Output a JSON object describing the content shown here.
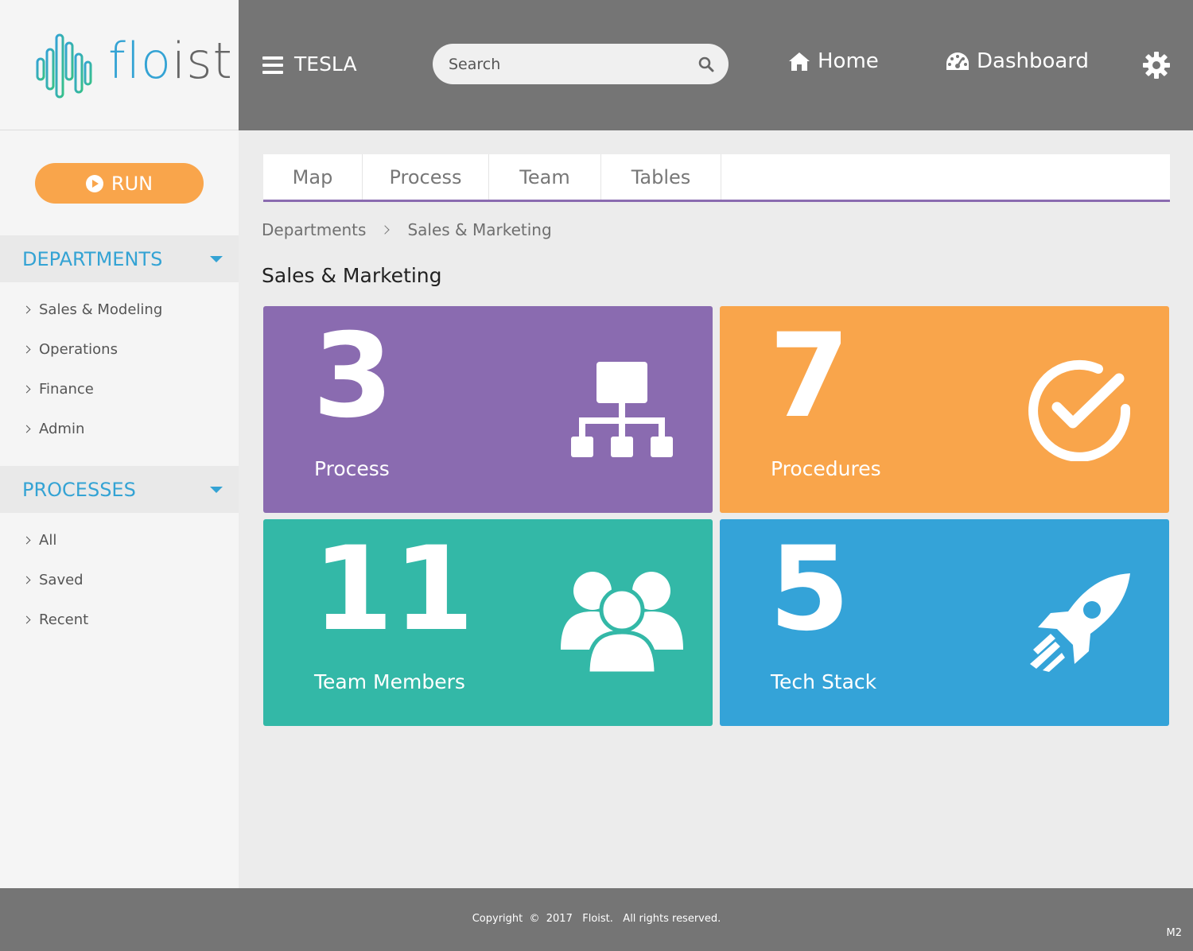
{
  "app": {
    "logo_text_main": "flo",
    "logo_text_tail": "ist"
  },
  "sidebar": {
    "run_label": "RUN",
    "sections": [
      {
        "title": "DEPARTMENTS",
        "items": [
          "Sales & Modeling",
          "Operations",
          "Finance",
          "Admin"
        ]
      },
      {
        "title": "PROCESSES",
        "items": [
          "All",
          "Saved",
          "Recent"
        ]
      }
    ]
  },
  "header": {
    "org_name": "TESLA",
    "search_placeholder": "Search",
    "home_label": "Home",
    "dashboard_label": "Dashboard"
  },
  "tabs": [
    "Map",
    "Process",
    "Team",
    "Tables"
  ],
  "breadcrumb": [
    "Departments",
    "Sales & Marketing"
  ],
  "page_title": "Sales & Marketing",
  "cards": [
    {
      "value": "3",
      "label": "Process",
      "color": "#8a6bb0",
      "icon": "sitemap-icon"
    },
    {
      "value": "7",
      "label": "Procedures",
      "color": "#f9a54b",
      "icon": "check-circle-icon"
    },
    {
      "value": "11",
      "label": "Team Members",
      "color": "#33b8a7",
      "icon": "users-icon"
    },
    {
      "value": "5",
      "label": "Tech Stack",
      "color": "#34a3d8",
      "icon": "rocket-icon"
    }
  ],
  "footer": {
    "copyright": "Copyright  ©  2017   Floist.   All rights reserved.",
    "version": "M2"
  }
}
